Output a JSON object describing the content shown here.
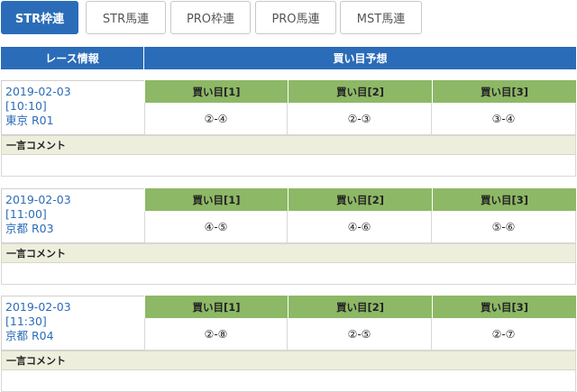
{
  "tabs": [
    {
      "label": "STR枠連",
      "active": true
    },
    {
      "label": "STR馬連",
      "active": false
    },
    {
      "label": "PRO枠連",
      "active": false
    },
    {
      "label": "PRO馬連",
      "active": false
    },
    {
      "label": "MST馬連",
      "active": false
    }
  ],
  "header": {
    "race_info": "レース情報",
    "prediction": "買い目予想"
  },
  "columns": [
    "買い目[1]",
    "買い目[2]",
    "買い目[3]"
  ],
  "comment_label": "一言コメント",
  "races": [
    {
      "date": "2019-02-03",
      "time": "[10:10]",
      "venue": "東京 R01",
      "picks": [
        "②-④",
        "②-③",
        "③-④"
      ],
      "comment": ""
    },
    {
      "date": "2019-02-03",
      "time": "[11:00]",
      "venue": "京都 R03",
      "picks": [
        "④-⑤",
        "④-⑥",
        "⑤-⑥"
      ],
      "comment": ""
    },
    {
      "date": "2019-02-03",
      "time": "[11:30]",
      "venue": "京都 R04",
      "picks": [
        "②-⑧",
        "②-⑤",
        "②-⑦"
      ],
      "comment": ""
    }
  ],
  "colors": {
    "accent": "#2b6cb8",
    "pick_header": "#8db866",
    "comment_bar": "#eeeedd"
  }
}
